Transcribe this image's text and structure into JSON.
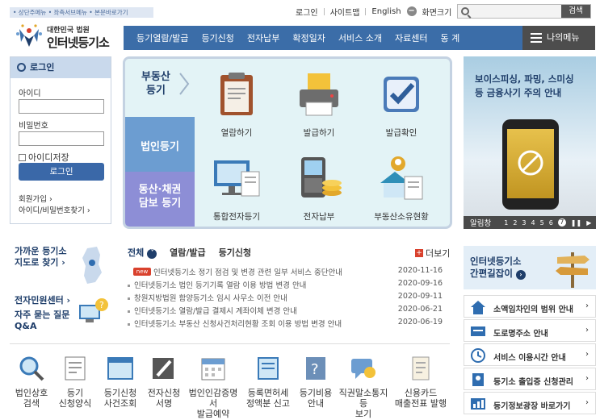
{
  "skip_links": "• 상단주메뉴 • 좌측서브메뉴 • 본문바로가기",
  "top_links": {
    "login": "로그인",
    "sitemap": "사이트맵",
    "english": "English",
    "zoom": "화면크기",
    "zoom_out": "−",
    "zoom_in": "+"
  },
  "search": {
    "placeholder": "",
    "button": "검색"
  },
  "logo": {
    "org": "대한민국 법원",
    "name": "인터넷등기소"
  },
  "gnb": {
    "items": [
      "등기열람/발급",
      "등기신청",
      "전자납부",
      "확정일자",
      "서비스 소개",
      "자료센터",
      "동 계"
    ],
    "mymenu": "나의메뉴"
  },
  "login": {
    "title": "로그인",
    "id_label": "아이디",
    "pw_label": "비밀번호",
    "save_id": "아이디저장",
    "button": "로그인",
    "join": "회원가입 ›",
    "find": "아이디/비밀번호찾기 ›"
  },
  "service": {
    "tabs": [
      "부동산\n등기",
      "법인등기",
      "동산·채권\n담보 등기"
    ],
    "items": [
      "열람하기",
      "발급하기",
      "발급확인",
      "통합전자등기",
      "전자납부",
      "부동산소유현황"
    ]
  },
  "banner": {
    "line1": "보이스피싱, 파밍, 스미싱",
    "line2": "등 금융사기 주의 안내",
    "bar_title": "알림창",
    "pages": [
      "1",
      "2",
      "3",
      "4",
      "5",
      "6",
      "7"
    ],
    "current": "7"
  },
  "quick_left": {
    "nearby_1": "가까운 등기소",
    "nearby_2": "지도로 찾기 ›",
    "civil": "전자민원센터 ›",
    "faq_1": "자주 묻는 질문",
    "faq_2": "Q&A"
  },
  "notice": {
    "tabs": [
      "전체",
      "열람/발급",
      "등기신청"
    ],
    "more": "더보기",
    "new_badge": "new",
    "rows": [
      {
        "title": "인터넷등기소 정기 점검 및 변경 관련 일부 서비스 중단안내",
        "date": "2020-11-16"
      },
      {
        "title": "인터넷등기소 법인 등기기록 열람 이용 방법 변경 안내",
        "date": "2020-09-16"
      },
      {
        "title": "창원지방법원 함양등기소 임시 사무소 이전 안내",
        "date": "2020-09-11"
      },
      {
        "title": "인터넷등기소 열람/발급 결제시 계좌이체 변경 안내",
        "date": "2020-06-21"
      },
      {
        "title": "인터넷등기소 부동산 신청사건처리현황 조회 이용 방법 변경 안내",
        "date": "2020-06-19"
      }
    ]
  },
  "bottom_icons": [
    [
      "법인상호",
      "검색"
    ],
    [
      "등기",
      "신청양식"
    ],
    [
      "등기신청",
      "사건조회"
    ],
    [
      "전자신청",
      "서명"
    ],
    [
      "법인인감증명서",
      "발급예약"
    ],
    [
      "등록면허세",
      "정액분 신고"
    ],
    [
      "등기비용",
      "안내"
    ],
    [
      "직권말소통지등",
      "보기"
    ],
    [
      "신용카드",
      "매출전표 발행"
    ]
  ],
  "guide": {
    "line1": "인터넷등기소",
    "line2": "간편길잡이"
  },
  "right_list": [
    "소액임차인의 범위 안내",
    "도로명주소 안내",
    "서비스 이용시간 안내",
    "등기소 출입증 신청관리",
    "등기정보광장 바로가기"
  ],
  "colors": {
    "primary": "#3b6da8",
    "header_dark": "#4d4d4d",
    "new_badge": "#d9412d",
    "panel_bg": "#e3f3f6"
  }
}
